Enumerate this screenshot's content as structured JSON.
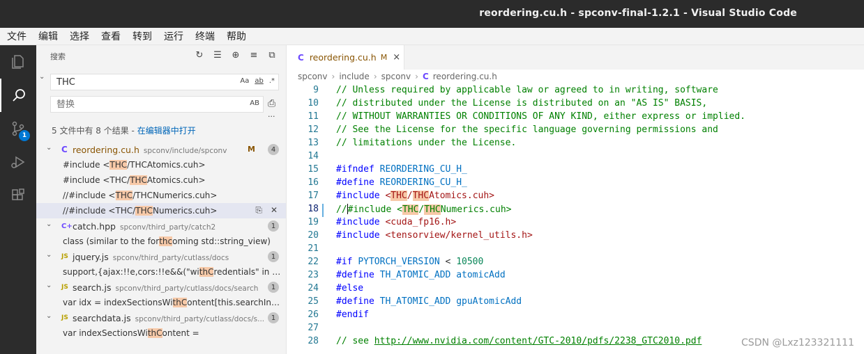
{
  "window": {
    "title": "reordering.cu.h - spconv-final-1.2.1 - Visual Studio Code"
  },
  "menu": [
    "文件",
    "编辑",
    "选择",
    "查看",
    "转到",
    "运行",
    "终端",
    "帮助"
  ],
  "activity": {
    "scm_badge": "1"
  },
  "search": {
    "header": "搜索",
    "query": "THC",
    "replace_placeholder": "替换",
    "opt_case": "Aa",
    "opt_word": "ab",
    "opt_regex": ".*",
    "opt_preserve": "AB",
    "more": "···",
    "summary": "5 文件中有 8 个结果 - ",
    "open_in_editor": "在编辑器中打开"
  },
  "results": [
    {
      "icon": "C",
      "name": "reordering.cu.h",
      "path": "spconv/include/spconv",
      "modified": "M",
      "count": "4",
      "matches": [
        {
          "pre": "#include <",
          "hit": "THC",
          "post": "/THCAtomics.cuh>"
        },
        {
          "pre": "#include <THC/",
          "hit": "THC",
          "post": "Atomics.cuh>"
        },
        {
          "pre": "//#include <",
          "hit": "THC",
          "post": "/THCNumerics.cuh>"
        },
        {
          "pre": "//#include <THC/",
          "hit": "THC",
          "post": "Numerics.cuh>"
        }
      ]
    },
    {
      "icon": "C+",
      "name": "catch.hpp",
      "path": "spconv/third_party/catch2",
      "count": "1",
      "matches": [
        {
          "pre": "class (similar to the for",
          "hit": "thc",
          "post": "oming std::string_view)"
        }
      ]
    },
    {
      "icon": "JS",
      "name": "jquery.js",
      "path": "spconv/third_party/cutlass/docs",
      "count": "1",
      "matches": [
        {
          "pre": "support,{ajax:!!e,cors:!!e&&(\"wi",
          "hit": "thC",
          "post": "redentials\" in e)}}}..."
        }
      ]
    },
    {
      "icon": "JS",
      "name": "search.js",
      "path": "spconv/third_party/cutlass/docs/search",
      "count": "1",
      "matches": [
        {
          "pre": "var idx = indexSectionsWi",
          "hit": "thC",
          "post": "ontent[this.searchInde..."
        }
      ]
    },
    {
      "icon": "JS",
      "name": "searchdata.js",
      "path": "spconv/third_party/cutlass/docs/s...",
      "count": "1",
      "matches": [
        {
          "pre": "var indexSectionsWi",
          "hit": "thC",
          "post": "ontent ="
        }
      ]
    }
  ],
  "editor": {
    "tab": {
      "icon": "C",
      "name": "reordering.cu.h",
      "modified": "M",
      "close": "×"
    },
    "breadcrumbs": [
      "spconv",
      "include",
      "spconv",
      "reordering.cu.h"
    ],
    "lines": [
      {
        "n": "9",
        "text": "// Unless required by applicable law or agreed to in writing, software"
      },
      {
        "n": "10",
        "text": "// distributed under the License is distributed on an \"AS IS\" BASIS,"
      },
      {
        "n": "11",
        "text": "// WITHOUT WARRANTIES OR CONDITIONS OF ANY KIND, either express or implied."
      },
      {
        "n": "12",
        "text": "// See the License for the specific language governing permissions and"
      },
      {
        "n": "13",
        "text": "// limitations under the License."
      },
      {
        "n": "14",
        "text": ""
      },
      {
        "n": "15",
        "text": "#ifndef REORDERING_CU_H_"
      },
      {
        "n": "16",
        "text": "#define REORDERING_CU_H_"
      },
      {
        "n": "17",
        "text": "#include <THC/THCAtomics.cuh>"
      },
      {
        "n": "18",
        "text": "//#include <THC/THCNumerics.cuh>"
      },
      {
        "n": "19",
        "text": "#include <cuda_fp16.h>"
      },
      {
        "n": "20",
        "text": "#include <tensorview/kernel_utils.h>"
      },
      {
        "n": "21",
        "text": ""
      },
      {
        "n": "22",
        "text": "#if PYTORCH_VERSION < 10500"
      },
      {
        "n": "23",
        "text": "#define TH_ATOMIC_ADD atomicAdd"
      },
      {
        "n": "24",
        "text": "#else"
      },
      {
        "n": "25",
        "text": "#define TH_ATOMIC_ADD gpuAtomicAdd"
      },
      {
        "n": "26",
        "text": "#endif"
      },
      {
        "n": "27",
        "text": ""
      },
      {
        "n": "28",
        "text": "// see http://www.nvidia.com/content/GTC-2010/pdfs/2238_GTC2010.pdf"
      }
    ]
  },
  "watermark": "CSDN @Lxz123321111"
}
